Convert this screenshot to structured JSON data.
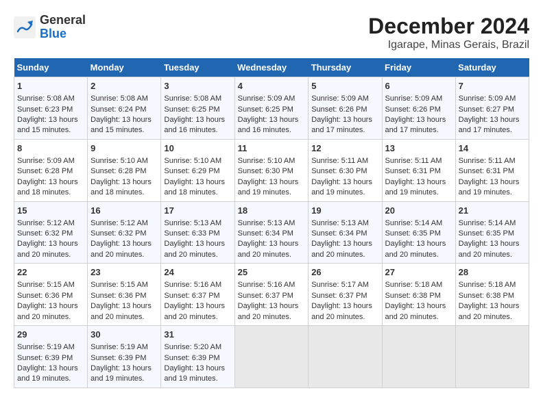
{
  "logo": {
    "part1": "General",
    "part2": "Blue"
  },
  "title": "December 2024",
  "subtitle": "Igarape, Minas Gerais, Brazil",
  "days_of_week": [
    "Sunday",
    "Monday",
    "Tuesday",
    "Wednesday",
    "Thursday",
    "Friday",
    "Saturday"
  ],
  "weeks": [
    [
      {
        "day": "1",
        "sunrise": "5:08 AM",
        "sunset": "6:23 PM",
        "daylight": "13 hours and 15 minutes."
      },
      {
        "day": "2",
        "sunrise": "5:08 AM",
        "sunset": "6:24 PM",
        "daylight": "13 hours and 15 minutes."
      },
      {
        "day": "3",
        "sunrise": "5:08 AM",
        "sunset": "6:25 PM",
        "daylight": "13 hours and 16 minutes."
      },
      {
        "day": "4",
        "sunrise": "5:09 AM",
        "sunset": "6:25 PM",
        "daylight": "13 hours and 16 minutes."
      },
      {
        "day": "5",
        "sunrise": "5:09 AM",
        "sunset": "6:26 PM",
        "daylight": "13 hours and 17 minutes."
      },
      {
        "day": "6",
        "sunrise": "5:09 AM",
        "sunset": "6:26 PM",
        "daylight": "13 hours and 17 minutes."
      },
      {
        "day": "7",
        "sunrise": "5:09 AM",
        "sunset": "6:27 PM",
        "daylight": "13 hours and 17 minutes."
      }
    ],
    [
      {
        "day": "8",
        "sunrise": "5:09 AM",
        "sunset": "6:28 PM",
        "daylight": "13 hours and 18 minutes."
      },
      {
        "day": "9",
        "sunrise": "5:10 AM",
        "sunset": "6:28 PM",
        "daylight": "13 hours and 18 minutes."
      },
      {
        "day": "10",
        "sunrise": "5:10 AM",
        "sunset": "6:29 PM",
        "daylight": "13 hours and 18 minutes."
      },
      {
        "day": "11",
        "sunrise": "5:10 AM",
        "sunset": "6:30 PM",
        "daylight": "13 hours and 19 minutes."
      },
      {
        "day": "12",
        "sunrise": "5:11 AM",
        "sunset": "6:30 PM",
        "daylight": "13 hours and 19 minutes."
      },
      {
        "day": "13",
        "sunrise": "5:11 AM",
        "sunset": "6:31 PM",
        "daylight": "13 hours and 19 minutes."
      },
      {
        "day": "14",
        "sunrise": "5:11 AM",
        "sunset": "6:31 PM",
        "daylight": "13 hours and 19 minutes."
      }
    ],
    [
      {
        "day": "15",
        "sunrise": "5:12 AM",
        "sunset": "6:32 PM",
        "daylight": "13 hours and 20 minutes."
      },
      {
        "day": "16",
        "sunrise": "5:12 AM",
        "sunset": "6:32 PM",
        "daylight": "13 hours and 20 minutes."
      },
      {
        "day": "17",
        "sunrise": "5:13 AM",
        "sunset": "6:33 PM",
        "daylight": "13 hours and 20 minutes."
      },
      {
        "day": "18",
        "sunrise": "5:13 AM",
        "sunset": "6:34 PM",
        "daylight": "13 hours and 20 minutes."
      },
      {
        "day": "19",
        "sunrise": "5:13 AM",
        "sunset": "6:34 PM",
        "daylight": "13 hours and 20 minutes."
      },
      {
        "day": "20",
        "sunrise": "5:14 AM",
        "sunset": "6:35 PM",
        "daylight": "13 hours and 20 minutes."
      },
      {
        "day": "21",
        "sunrise": "5:14 AM",
        "sunset": "6:35 PM",
        "daylight": "13 hours and 20 minutes."
      }
    ],
    [
      {
        "day": "22",
        "sunrise": "5:15 AM",
        "sunset": "6:36 PM",
        "daylight": "13 hours and 20 minutes."
      },
      {
        "day": "23",
        "sunrise": "5:15 AM",
        "sunset": "6:36 PM",
        "daylight": "13 hours and 20 minutes."
      },
      {
        "day": "24",
        "sunrise": "5:16 AM",
        "sunset": "6:37 PM",
        "daylight": "13 hours and 20 minutes."
      },
      {
        "day": "25",
        "sunrise": "5:16 AM",
        "sunset": "6:37 PM",
        "daylight": "13 hours and 20 minutes."
      },
      {
        "day": "26",
        "sunrise": "5:17 AM",
        "sunset": "6:37 PM",
        "daylight": "13 hours and 20 minutes."
      },
      {
        "day": "27",
        "sunrise": "5:18 AM",
        "sunset": "6:38 PM",
        "daylight": "13 hours and 20 minutes."
      },
      {
        "day": "28",
        "sunrise": "5:18 AM",
        "sunset": "6:38 PM",
        "daylight": "13 hours and 20 minutes."
      }
    ],
    [
      {
        "day": "29",
        "sunrise": "5:19 AM",
        "sunset": "6:39 PM",
        "daylight": "13 hours and 19 minutes."
      },
      {
        "day": "30",
        "sunrise": "5:19 AM",
        "sunset": "6:39 PM",
        "daylight": "13 hours and 19 minutes."
      },
      {
        "day": "31",
        "sunrise": "5:20 AM",
        "sunset": "6:39 PM",
        "daylight": "13 hours and 19 minutes."
      },
      null,
      null,
      null,
      null
    ]
  ]
}
